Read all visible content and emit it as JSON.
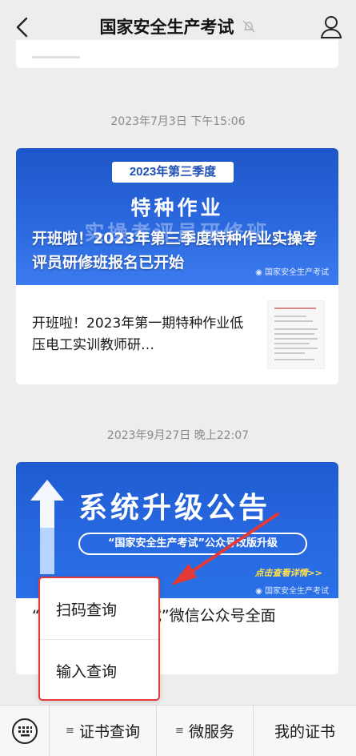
{
  "header": {
    "title": "国家安全生产考试",
    "back_icon": "chevron-left-icon",
    "mute_icon": "bell-slash-icon",
    "profile_icon": "person-icon"
  },
  "messages": [
    {
      "timestamp": "2023年7月3日 下午15:06",
      "banner": {
        "badge": "2023年第三季度",
        "headline": "特种作业",
        "subheadline": "实操考评员研修班",
        "watermark": "国家安全生产考试",
        "title": "开班啦！2023年第三季度特种作业实操考评员研修班报名已开始"
      },
      "sub_article": {
        "text": "开班啦！2023年第一期特种作业低压电工实训教师研…"
      }
    },
    {
      "timestamp": "2023年9月27日 晚上22:07",
      "banner": {
        "headline": "系统升级公告",
        "pill": "“国家安全生产考试”公众号改版升级",
        "tap_hint": "点击查看详情>>",
        "watermark": "国家安全生产考试"
      },
      "title": "“国家安全生产考试”微信公众号全面"
    }
  ],
  "popup_menu": {
    "items": [
      "扫码查询",
      "输入查询"
    ]
  },
  "tabbar": {
    "keyboard_icon": "keyboard-icon",
    "tabs": [
      "证书查询",
      "微服务",
      "我的证书"
    ]
  },
  "colors": {
    "accent_red": "#e53935",
    "banner_blue": "#2463d8"
  }
}
